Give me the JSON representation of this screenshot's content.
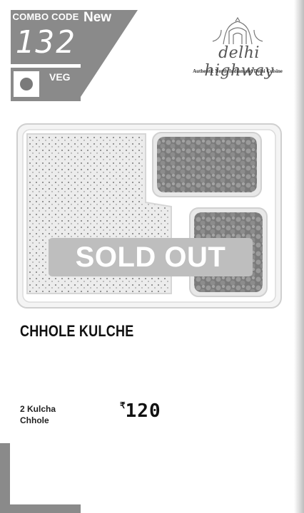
{
  "combo": {
    "label": "COMBO CODE",
    "code": "132",
    "badge": "New",
    "diet_label": "VEG"
  },
  "brand": {
    "name": "delhi highway",
    "tagline": "Authentic North Indian and Delhi Cuisine"
  },
  "overlay": {
    "sold_out_label": "SOLD OUT",
    "banner_color": "#bebebe"
  },
  "dish": {
    "name": "CHHOLE KULCHE",
    "items": [
      "2 Kulcha",
      "Chhole"
    ],
    "currency_symbol": "₹",
    "price": "120"
  },
  "icons": {
    "veg_indicator": "veg-dot-icon",
    "logo_emblem": "india-gate-icon"
  }
}
